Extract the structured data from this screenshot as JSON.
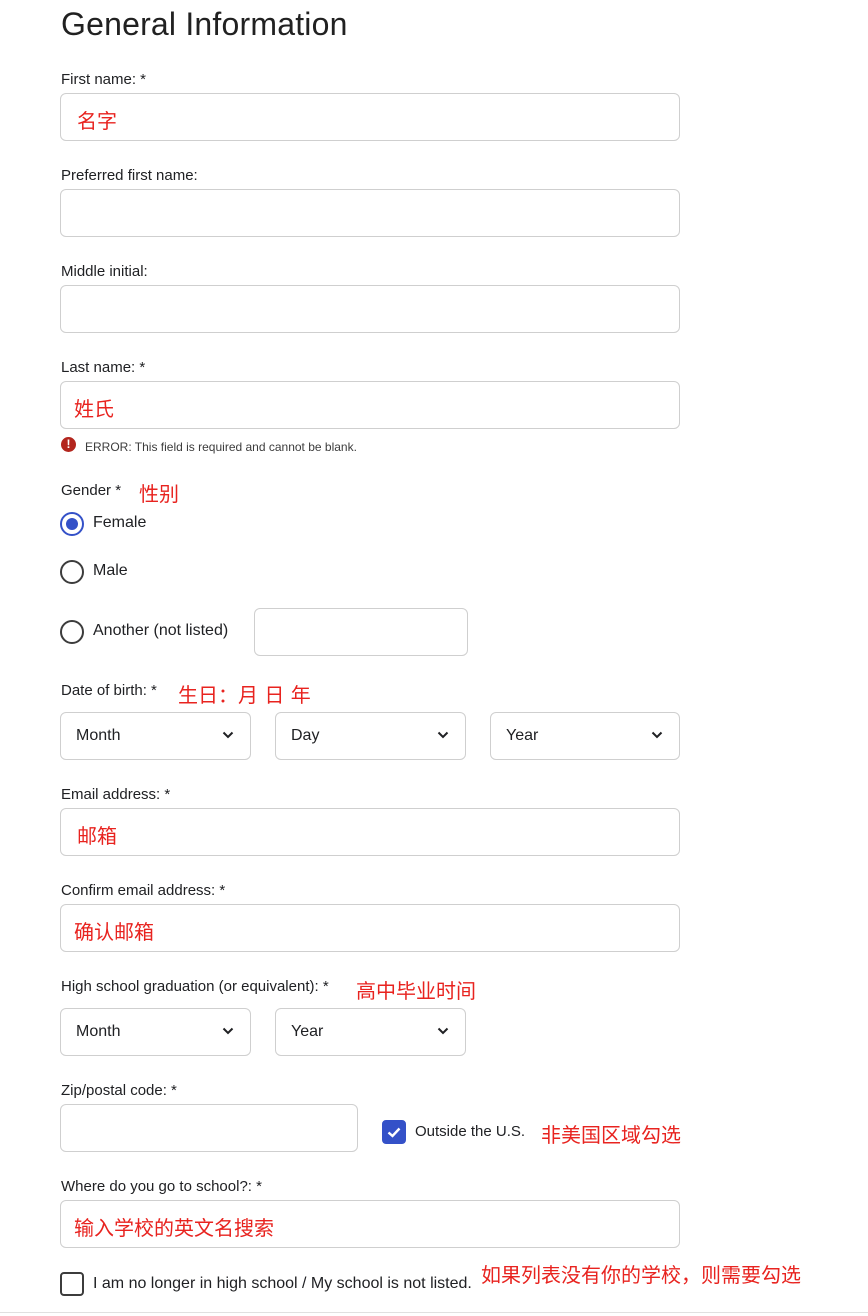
{
  "page": {
    "title": "General Information"
  },
  "fields": {
    "first_name": {
      "label": "First name: *",
      "value": "名字"
    },
    "preferred_first_name": {
      "label": "Preferred first name:",
      "value": ""
    },
    "middle_initial": {
      "label": "Middle initial:",
      "value": ""
    },
    "last_name": {
      "label": "Last name: *",
      "value": "姓氏",
      "error": "ERROR: This field is required and cannot be blank."
    },
    "gender": {
      "label": "Gender *",
      "note": "性别",
      "options": [
        "Female",
        "Male",
        "Another (not listed)"
      ],
      "selected": "Female",
      "other_value": ""
    },
    "date_of_birth": {
      "label": "Date of birth:  *",
      "note": "生日：月 日 年",
      "month": "Month",
      "day": "Day",
      "year": "Year"
    },
    "email": {
      "label": "Email address: *",
      "value": "邮箱"
    },
    "confirm_email": {
      "label": "Confirm email address: *",
      "value": "确认邮箱"
    },
    "hs_graduation": {
      "label": "High school graduation (or equivalent):  *",
      "note": "高中毕业时间",
      "month": "Month",
      "year": "Year"
    },
    "zip": {
      "label": "Zip/postal code: *",
      "value": "",
      "outside_us_label": "Outside the U.S.",
      "outside_us_checked": true,
      "note": "非美国区域勾选"
    },
    "school": {
      "label": "Where do you go to school?: *",
      "value": "输入学校的英文名搜索",
      "not_listed_label": "I am no longer in high school / My school is not listed.",
      "not_listed_checked": false,
      "note": "如果列表没有你的学校，则需要勾选"
    }
  },
  "colors": {
    "accent": "#3451c8",
    "annotation": "#e8231f",
    "error": "#b3261e",
    "border": "#cfcfcf"
  }
}
